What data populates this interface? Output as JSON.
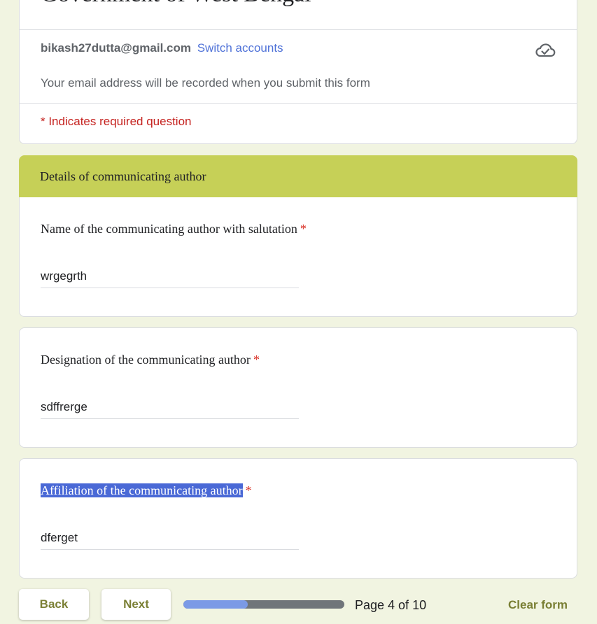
{
  "form": {
    "title": "Government of West Bengal",
    "account_email": "bikash27dutta@gmail.com",
    "switch_accounts": "Switch accounts",
    "email_notice": "Your email address will be recorded when you submit this form",
    "required_notice": "* Indicates required question"
  },
  "section": {
    "title": "Details of communicating author"
  },
  "questions": [
    {
      "label": "Name of the communicating author with salutation",
      "required_mark": "*",
      "answer": "wrgegrth"
    },
    {
      "label": "Designation of the communicating author",
      "required_mark": "*",
      "answer": "sdffrerge"
    },
    {
      "label": "Affiliation of the communicating author",
      "required_mark": "*",
      "answer": "dferget"
    }
  ],
  "footer": {
    "back_label": "Back",
    "next_label": "Next",
    "page_indicator": "Page 4 of 10",
    "progress_fraction": 0.4,
    "clear_label": "Clear form"
  },
  "colors": {
    "accent": "#c6d057",
    "link": "#4f72d8",
    "required": "#c5221f",
    "button_text": "#7a7f34",
    "progress_fill": "#7b9ae6",
    "progress_track": "#70757a"
  },
  "icons": {
    "cloud": "cloud-check-icon"
  }
}
